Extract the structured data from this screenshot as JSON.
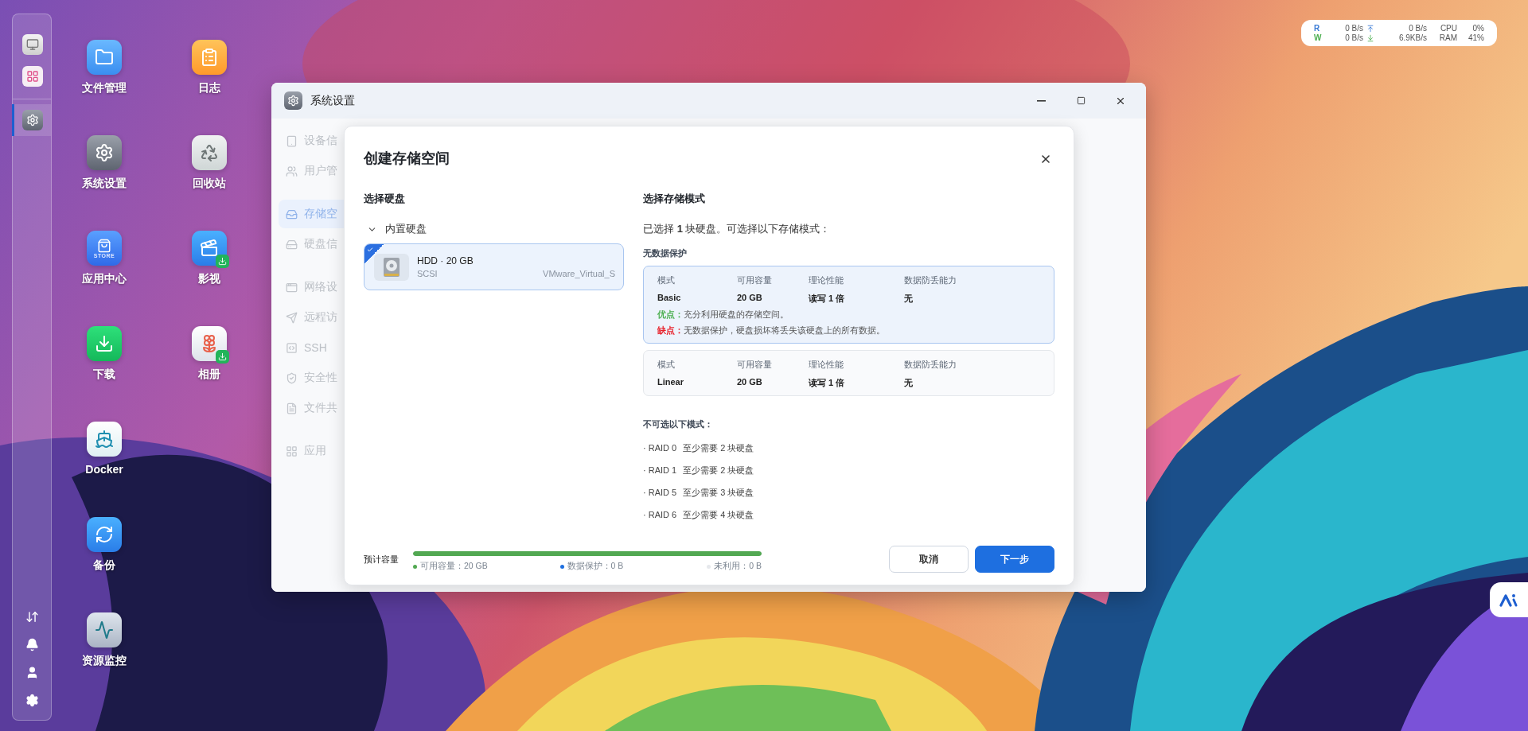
{
  "desktop": {
    "dock": {
      "top_items": [
        {
          "kind": "monitor",
          "selected": false
        },
        {
          "kind": "apps",
          "selected": false
        }
      ],
      "running": [
        {
          "kind": "settings",
          "selected": true
        }
      ],
      "bottom_items": [
        {
          "kind": "transfer"
        },
        {
          "kind": "bell"
        },
        {
          "kind": "user"
        },
        {
          "kind": "gear"
        }
      ]
    },
    "icons": [
      {
        "kind": "folder",
        "label": "文件管理"
      },
      {
        "kind": "settings",
        "label": "系统设置"
      },
      {
        "kind": "store",
        "label": "应用中心",
        "badge": "STORE"
      },
      {
        "kind": "download",
        "label": "下载"
      },
      {
        "kind": "docker",
        "label": "Docker"
      },
      {
        "kind": "backup",
        "label": "备份"
      },
      {
        "kind": "monitor",
        "label": "资源监控"
      },
      {
        "kind": "notes",
        "label": "日志"
      },
      {
        "kind": "recycle",
        "label": "回收站"
      },
      {
        "kind": "video",
        "label": "影视"
      },
      {
        "kind": "photos",
        "label": "相册"
      }
    ]
  },
  "status_widget": {
    "rows": [
      {
        "label": "R",
        "color": "#3a7bd5",
        "disk": "0 B/s",
        "kind": "up",
        "net": "0 B/s",
        "metric": "CPU",
        "value": "0%"
      },
      {
        "label": "W",
        "color": "#4caf50",
        "disk": "0 B/s",
        "kind": "down",
        "net": "6.9KB/s",
        "metric": "RAM",
        "value": "41%"
      }
    ]
  },
  "window": {
    "title": "系统设置",
    "sidebar": {
      "groups": [
        {
          "items": [
            {
              "kind": "device",
              "label": "设备信",
              "selected": false
            },
            {
              "kind": "user",
              "label": "用户管",
              "selected": false
            }
          ]
        },
        {
          "items": [
            {
              "kind": "storage",
              "label": "存储空",
              "selected": true
            },
            {
              "kind": "disk",
              "label": "硬盘信",
              "selected": false
            }
          ]
        },
        {
          "items": [
            {
              "kind": "network",
              "label": "网络设",
              "selected": false
            },
            {
              "kind": "remote",
              "label": "远程访",
              "selected": false
            },
            {
              "kind": "ssh",
              "label": "SSH",
              "selected": false
            },
            {
              "kind": "security",
              "label": "安全性",
              "selected": false
            },
            {
              "kind": "share",
              "label": "文件共",
              "selected": false
            }
          ]
        },
        {
          "items": [
            {
              "kind": "apps",
              "label": "应用",
              "selected": false
            }
          ]
        }
      ]
    }
  },
  "dialog": {
    "title": "创建存储空间",
    "disk_panel": {
      "heading": "选择硬盘",
      "group": {
        "label": "内置硬盘",
        "expanded": true,
        "disks": [
          {
            "name": "HDD · 20 GB",
            "bus": "SCSI",
            "model": "VMware_Virtual_S",
            "selected": true
          }
        ]
      }
    },
    "mode_panel": {
      "heading": "选择存储模式",
      "summary": "已选择 **1** 块硬盘。可选择以下存储模式：",
      "category": "无数据保护",
      "modes": [
        {
          "selected": true,
          "fields": [
            {
              "label": "模式",
              "value": "Basic"
            },
            {
              "label": "可用容量",
              "value": "20 GB"
            },
            {
              "label": "理论性能",
              "value": "读写 1 倍"
            },
            {
              "label": "数据防丢能力",
              "value": "无"
            }
          ],
          "pros": {
            "label": "优点：",
            "text": "充分利用硬盘的存储空间。"
          },
          "cons": {
            "label": "缺点：",
            "text": "无数据保护，硬盘损坏将丢失该硬盘上的所有数据。"
          }
        },
        {
          "selected": false,
          "fields": [
            {
              "label": "模式",
              "value": "Linear"
            },
            {
              "label": "可用容量",
              "value": "20 GB"
            },
            {
              "label": "理论性能",
              "value": "读写 1 倍"
            },
            {
              "label": "数据防丢能力",
              "value": "无"
            }
          ]
        }
      ],
      "unavailable_heading": "不可选以下模式：",
      "unavailable": [
        {
          "mode": "· RAID 0",
          "requirement": "至少需要 2 块硬盘"
        },
        {
          "mode": "· RAID 1",
          "requirement": "至少需要 2 块硬盘"
        },
        {
          "mode": "· RAID 5",
          "requirement": "至少需要 3 块硬盘"
        },
        {
          "mode": "· RAID 6",
          "requirement": "至少需要 4 块硬盘"
        }
      ]
    },
    "footer": {
      "label": "预计容量",
      "usage": {
        "level": 1
      },
      "legend": [
        {
          "label": "可用容量：20 GB",
          "color": "#52a852"
        },
        {
          "label": "数据保护：0 B",
          "color": "#1e6fe0"
        },
        {
          "label": "未利用：0 B",
          "color": "#e6e8ec"
        }
      ],
      "buttons": [
        {
          "label": "取消",
          "kind": "secondary"
        },
        {
          "label": "下一步",
          "kind": "primary"
        }
      ]
    }
  }
}
